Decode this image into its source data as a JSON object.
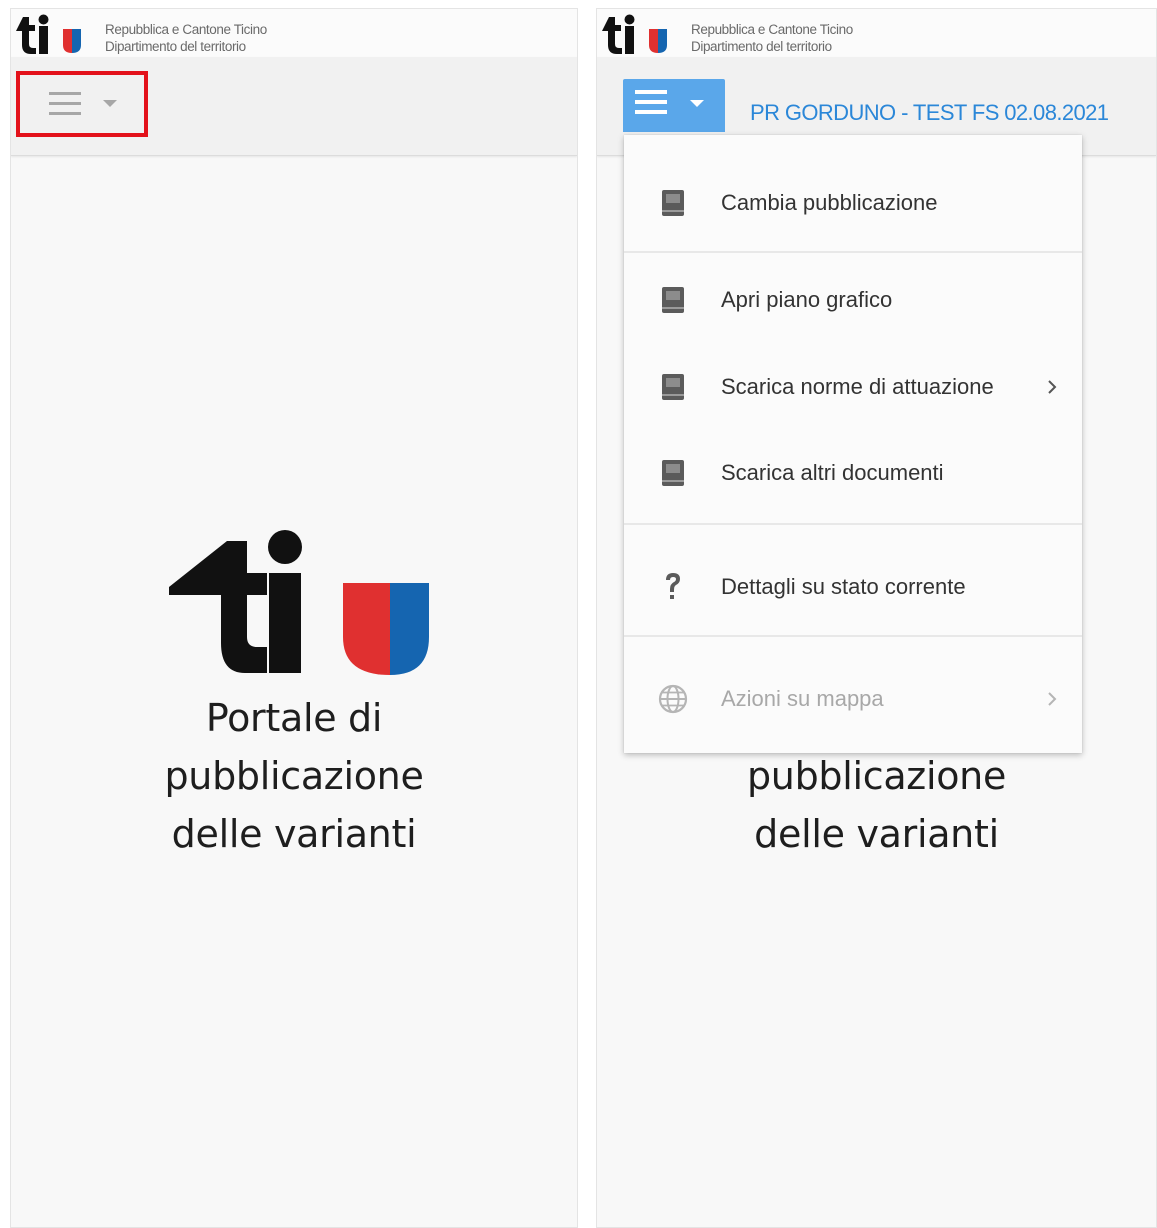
{
  "header": {
    "gov_line1": "Repubblica e Cantone Ticino",
    "gov_line2": "Dipartimento del territorio"
  },
  "left_panel": {
    "portal_line1": "Portale di",
    "portal_line2": "pubblicazione",
    "portal_line3": "delle varianti"
  },
  "right_panel": {
    "publication_title": "PR GORDUNO - TEST FS 02.08.2021",
    "portal_line2": "pubblicazione",
    "portal_line3": "delle varianti",
    "menu": {
      "items": [
        {
          "label": "Cambia pubblicazione",
          "icon": "book-icon"
        },
        {
          "label": "Apri piano grafico",
          "icon": "book-icon"
        },
        {
          "label": "Scarica norme di attuazione",
          "icon": "book-icon",
          "submenu": true
        },
        {
          "label": "Scarica altri documenti",
          "icon": "book-icon"
        },
        {
          "label": "Dettagli su stato corrente",
          "icon": "question-icon"
        },
        {
          "label": "Azioni su mappa",
          "icon": "globe-icon",
          "submenu": true,
          "disabled": true
        }
      ]
    }
  },
  "colors": {
    "highlight": "#e3121b",
    "menu_button": "#5aa7ea",
    "title_blue": "#2b87d8",
    "flag_red": "#e03030",
    "flag_blue": "#1565b0"
  }
}
